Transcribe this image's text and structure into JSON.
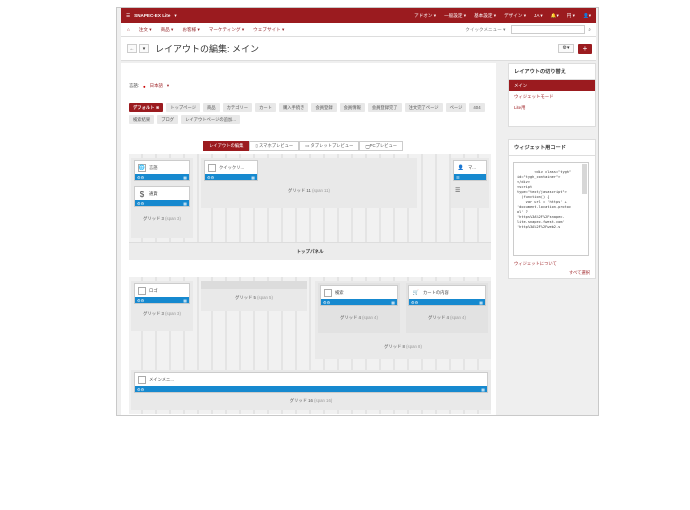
{
  "topbar": {
    "brand": "SNAPEC-EX Lite",
    "menu": [
      "アドオン",
      "一般設定",
      "基本設定",
      "デザイン",
      "JA",
      "円"
    ]
  },
  "subnav": {
    "items": [
      "注文",
      "商品",
      "お客様",
      "マーケティング",
      "ウェブサイト"
    ],
    "quick_menu": "クイックメニュー"
  },
  "titlebar": {
    "title": "レイアウトの編集: メイン",
    "add": "+"
  },
  "main": {
    "language_label": "言語:",
    "language_value": "日本語",
    "tags": [
      "デフォルト",
      "トップページ",
      "商品",
      "カテゴリー",
      "カート",
      "購入手続き",
      "会員登録",
      "会員情報",
      "会員登録完了",
      "注文完了ページ",
      "ページ",
      "404",
      "検索結果",
      "ブログ",
      "レイアウトページの追加..."
    ],
    "previews": [
      "レイアウトの編集",
      "スマホプレビュー",
      "タブレットプレビュー",
      "PCプレビュー"
    ],
    "panel1": {
      "g3_label": "グリッド 3",
      "g3_span": "(span 3)",
      "w_lang": "言語",
      "w_currency": "通貨",
      "w_quick": "クイックリ...",
      "g11_label": "グリッド 11",
      "g11_span": "(span 11)",
      "w_member": "マ...",
      "top_panel": "トップパネル"
    },
    "panel2": {
      "w_logo": "ロゴ",
      "g3_label": "グリッド 3",
      "g3_span": "(span 3)",
      "g5_label": "グリッド 5",
      "g5_span": "(span 5)",
      "w_search": "検索",
      "w_cart": "カートの内容",
      "g4a_label": "グリッド 4",
      "g4a_span": "(span 4)",
      "g4b_label": "グリッド 4",
      "g4b_span": "(span 4)",
      "g8_label": "グリッド 8",
      "g8_span": "(span 8)",
      "w_mainmenu": "メインメニ...",
      "g16_label": "グリッド 16",
      "g16_span": "(span 16)"
    }
  },
  "sidebar": {
    "switch_title": "レイアウトの切り替え",
    "switch_items": [
      "メイン",
      "ウィジェットモード",
      "Lite用"
    ],
    "code_title": "ウィジェット用コード",
    "code_text": "<div class=\"tygh\"\nid=\"tygh_container\">\n</div>\n<script\ntype=\"text/javascript\">\n  (function() {\n    var url = 'https' +\n'document.location.protoc\nol' ?\n'https%3A%2F%2Fsnapec-lite.snapec-fwest.com'\n'http%3A%2F%2Fweb2.s",
    "about_widgets": "ウィジェットについて",
    "select_all": "すべて選択"
  }
}
